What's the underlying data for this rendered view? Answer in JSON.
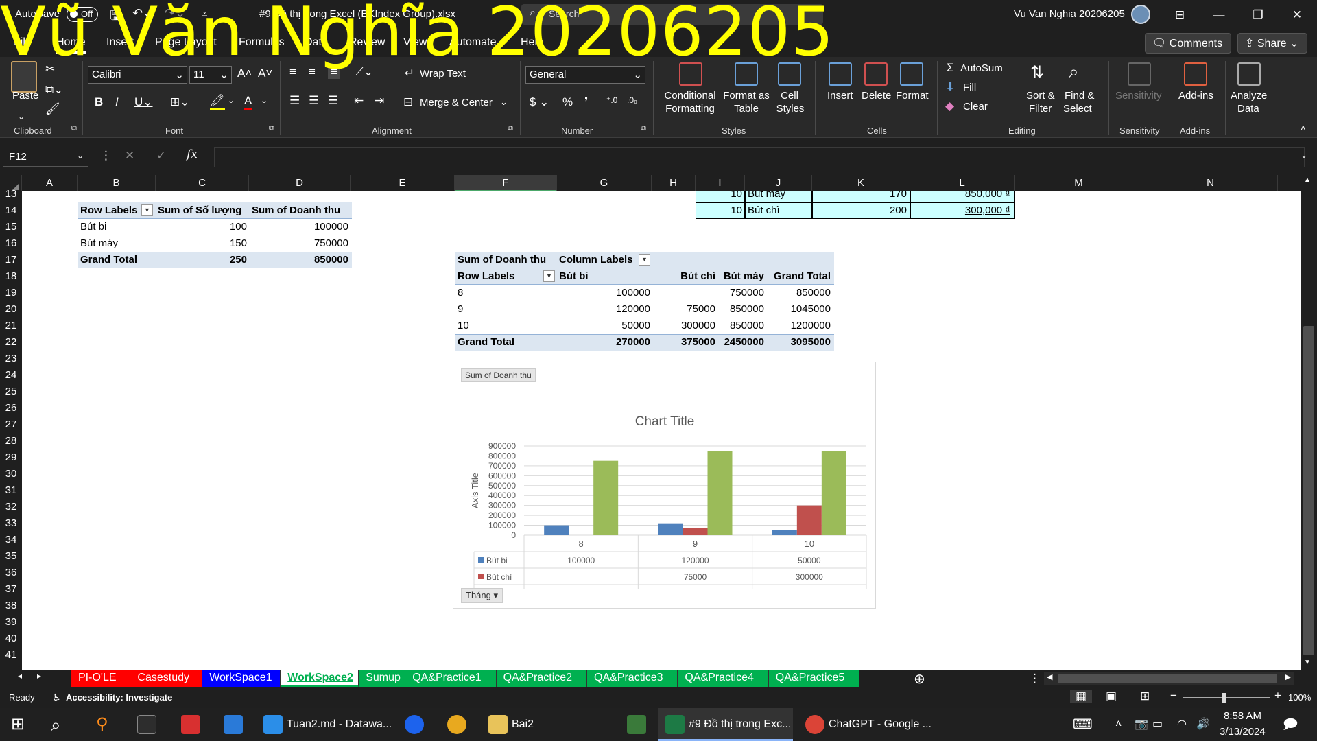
{
  "titlebar": {
    "autosave": "AutoSave",
    "toggle": "Off",
    "filename": "#9 Đồ thị trong Excel (BKIndex Group).xlsx",
    "search": "Search",
    "user": "Vu Van Nghia 20206205"
  },
  "overlay": "Vũ Văn Nghĩa 20206205",
  "tabs": [
    "File",
    "Home",
    "Insert",
    "Page Layout",
    "Formulas",
    "Data",
    "Review",
    "View",
    "Automate",
    "Help"
  ],
  "comments": "Comments",
  "share": "Share",
  "ribbon": {
    "clipboard": {
      "paste": "Paste",
      "group": "Clipboard"
    },
    "font": {
      "name": "Calibri",
      "size": "11",
      "group": "Font"
    },
    "alignment": {
      "wrap": "Wrap Text",
      "merge": "Merge & Center",
      "group": "Alignment"
    },
    "number": {
      "format": "General",
      "group": "Number"
    },
    "styles": {
      "cond1": "Conditional",
      "cond2": "Formatting",
      "fmt1": "Format as",
      "fmt2": "Table",
      "cell1": "Cell",
      "cell2": "Styles",
      "group": "Styles"
    },
    "cells": {
      "insert": "Insert",
      "delete": "Delete",
      "format": "Format",
      "group": "Cells"
    },
    "editing": {
      "autosum": "AutoSum",
      "fill": "Fill",
      "clear": "Clear",
      "sort1": "Sort &",
      "sort2": "Filter",
      "find1": "Find &",
      "find2": "Select",
      "group": "Editing"
    },
    "sensitivity": {
      "label": "Sensitivity",
      "group": "Sensitivity"
    },
    "addins": {
      "label": "Add-ins",
      "group": "Add-ins"
    },
    "analyze": {
      "l1": "Analyze",
      "l2": "Data"
    }
  },
  "namebox": "F12",
  "fx": "fx",
  "columns": [
    "A",
    "B",
    "C",
    "D",
    "E",
    "F",
    "G",
    "H",
    "I",
    "J",
    "K",
    "L",
    "M",
    "N"
  ],
  "rows": [
    "13",
    "14",
    "15",
    "16",
    "17",
    "18",
    "19",
    "20",
    "21",
    "22",
    "23",
    "24",
    "25",
    "26",
    "27",
    "28",
    "29",
    "30",
    "31",
    "32",
    "33",
    "34",
    "35",
    "36",
    "37",
    "38",
    "39",
    "40",
    "41"
  ],
  "pivot1": {
    "h1": "Row Labels",
    "h2": "Sum of Số lượng",
    "h3": "Sum of Doanh thu",
    "rows": [
      [
        "Bút bi",
        "100",
        "100000"
      ],
      [
        "Bút máy",
        "150",
        "750000"
      ]
    ],
    "total": [
      "Grand Total",
      "250",
      "850000"
    ]
  },
  "toptable": [
    [
      "10",
      "Bút máy",
      "170",
      "850,000 ₫"
    ],
    [
      "10",
      "Bút chì",
      "200",
      "300,000 ₫"
    ]
  ],
  "pivot2": {
    "corner": "Sum of Doanh thu",
    "collabels": "Column Labels",
    "rowlabels": "Row Labels",
    "cols": [
      "Bút bi",
      "Bút chì",
      "Bút máy",
      "Grand Total"
    ],
    "rows": [
      [
        "8",
        "100000",
        "",
        "750000",
        "850000"
      ],
      [
        "9",
        "120000",
        "75000",
        "850000",
        "1045000"
      ],
      [
        "10",
        "50000",
        "300000",
        "850000",
        "1200000"
      ]
    ],
    "total": [
      "Grand Total",
      "270000",
      "375000",
      "2450000",
      "3095000"
    ]
  },
  "chart_data": {
    "type": "bar",
    "title": "Chart Title",
    "field_button": "Sum of Doanh thu",
    "axis_field": "Tháng",
    "ylabel": "Axis Title",
    "ylim": [
      0,
      900000
    ],
    "yticks": [
      "900000",
      "800000",
      "700000",
      "600000",
      "500000",
      "400000",
      "300000",
      "200000",
      "100000",
      "0"
    ],
    "categories": [
      "8",
      "9",
      "10"
    ],
    "series": [
      {
        "name": "Bút bi",
        "color": "#4f81bd",
        "values": [
          100000,
          120000,
          50000
        ],
        "labels": [
          "100000",
          "120000",
          "50000"
        ]
      },
      {
        "name": "Bút chì",
        "color": "#c0504d",
        "values": [
          0,
          75000,
          300000
        ],
        "labels": [
          "",
          "75000",
          "300000"
        ]
      },
      {
        "name": "Bút máy",
        "color": "#9bbb59",
        "values": [
          750000,
          850000,
          850000
        ],
        "labels": [
          "750000",
          "850000",
          "850000"
        ]
      }
    ]
  },
  "sheettabs": [
    {
      "name": "PI-O'LE",
      "bg": "#ff0000",
      "fg": "#ffffff"
    },
    {
      "name": "Casestudy",
      "bg": "#ff0000",
      "fg": "#ffffff"
    },
    {
      "name": "WorkSpace1",
      "bg": "#0000ff",
      "fg": "#ffffff"
    },
    {
      "name": "WorkSpace2",
      "bg": "#ffffff",
      "fg": "#00b050"
    },
    {
      "name": "Sumup",
      "bg": "#00b050",
      "fg": "#ffffff"
    },
    {
      "name": "QA&Practice1",
      "bg": "#00b050",
      "fg": "#ffffff"
    },
    {
      "name": "QA&Practice2",
      "bg": "#00b050",
      "fg": "#ffffff"
    },
    {
      "name": "QA&Practice3",
      "bg": "#00b050",
      "fg": "#ffffff"
    },
    {
      "name": "QA&Practice4",
      "bg": "#00b050",
      "fg": "#ffffff"
    },
    {
      "name": "QA&Practice5",
      "bg": "#00b050",
      "fg": "#ffffff"
    }
  ],
  "status": {
    "ready": "Ready",
    "access": "Accessibility: Investigate",
    "zoom": "100%"
  },
  "taskbar": {
    "vscode": "Tuan2.md - Datawa...",
    "bai2": "Bai2",
    "excel": "#9 Đồ thị trong Exc...",
    "chrome": "ChatGPT - Google ...",
    "time": "8:58 AM",
    "date": "3/13/2024"
  }
}
